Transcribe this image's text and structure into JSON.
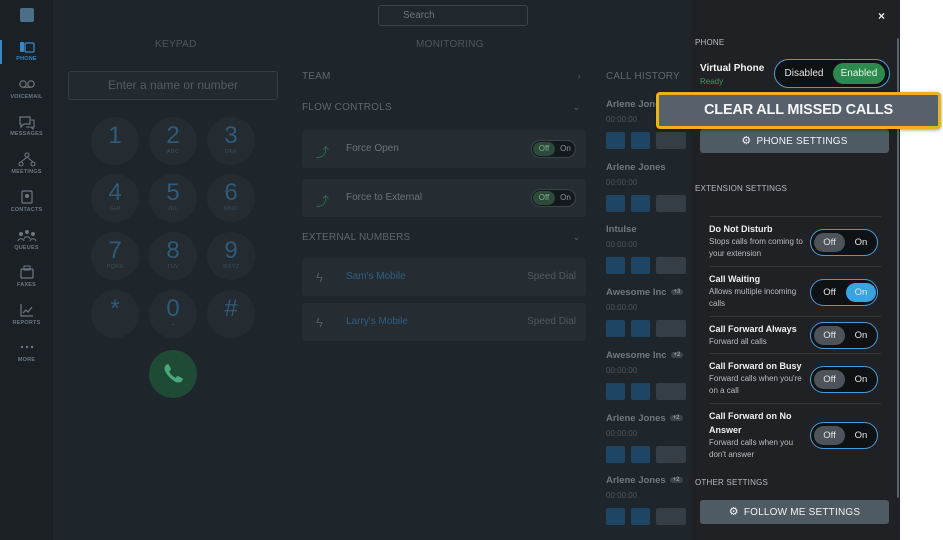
{
  "search": {
    "placeholder": "Search"
  },
  "tabs": [
    "KEYPAD",
    "MONITORING"
  ],
  "nav": [
    {
      "label": "PHONE",
      "icon": "phone-icon"
    },
    {
      "label": "VOICEMAIL",
      "icon": "voicemail-icon"
    },
    {
      "label": "MESSAGES",
      "icon": "messages-icon"
    },
    {
      "label": "MEETINGS",
      "icon": "meetings-icon"
    },
    {
      "label": "CONTACTS",
      "icon": "contacts-icon"
    },
    {
      "label": "QUEUES",
      "icon": "queues-icon"
    },
    {
      "label": "FAXES",
      "icon": "faxes-icon"
    },
    {
      "label": "REPORTS",
      "icon": "reports-icon"
    },
    {
      "label": "MORE",
      "icon": "more-icon"
    }
  ],
  "keypad": {
    "placeholder": "Enter a name or number",
    "keys": [
      {
        "d": "1",
        "s": ""
      },
      {
        "d": "2",
        "s": "ABC"
      },
      {
        "d": "3",
        "s": "DEF"
      },
      {
        "d": "4",
        "s": "GHI"
      },
      {
        "d": "5",
        "s": "JKL"
      },
      {
        "d": "6",
        "s": "MNO"
      },
      {
        "d": "7",
        "s": "PQRS"
      },
      {
        "d": "8",
        "s": "TUV"
      },
      {
        "d": "9",
        "s": "WXYZ"
      },
      {
        "d": "*",
        "s": ""
      },
      {
        "d": "0",
        "s": "+"
      },
      {
        "d": "#",
        "s": ""
      }
    ]
  },
  "monitoring": {
    "team": "TEAM",
    "flow_controls": "FLOW CONTROLS",
    "flows": [
      {
        "label": "Force Open",
        "off": "Off",
        "on": "On"
      },
      {
        "label": "Force to External",
        "off": "Off",
        "on": "On"
      }
    ],
    "external_numbers": "EXTERNAL NUMBERS",
    "externals": [
      {
        "label": "Sam's Mobile",
        "tag": "Speed Dial"
      },
      {
        "label": "Larry's Mobile",
        "tag": "Speed Dial"
      }
    ]
  },
  "call_history": {
    "title": "CALL HISTORY",
    "items": [
      {
        "name": "Arlene Jone",
        "time": "00:00:00",
        "badge": ""
      },
      {
        "name": "Arlene Jones",
        "time": "00:00:00",
        "badge": ""
      },
      {
        "name": "Intulse",
        "time": "00:00:00",
        "badge": ""
      },
      {
        "name": "Awesome Inc",
        "time": "00:00:00",
        "badge": "+3"
      },
      {
        "name": "Awesome Inc",
        "time": "00:00:00",
        "badge": "+2"
      },
      {
        "name": "Arlene Jones",
        "time": "00:00:00",
        "badge": "+2"
      },
      {
        "name": "Arlene Jones",
        "time": "00:00:00",
        "badge": "+2"
      }
    ]
  },
  "panel": {
    "close": "×",
    "phone_heading": "PHONE",
    "virtual_phone": {
      "label": "Virtual Phone",
      "status": "Ready",
      "disabled": "Disabled",
      "enabled": "Enabled"
    },
    "clear_missed": "CLEAR ALL MISSED CALLS",
    "phone_settings": "PHONE SETTINGS",
    "extension_heading": "EXTENSION SETTINGS",
    "settings": [
      {
        "title": "Do Not Disturb",
        "desc": "Stops calls from coming to your extension",
        "off": "Off",
        "on": "On",
        "state": "on"
      },
      {
        "title": "Call Waiting",
        "desc": "Allows multiple incoming calls",
        "off": "Off",
        "on": "On",
        "state": "on"
      },
      {
        "title": "Call Forward Always",
        "desc": "Forward all calls",
        "off": "Off",
        "on": "On",
        "state": "off"
      },
      {
        "title": "Call Forward on Busy",
        "desc": "Forward calls when you're on a call",
        "off": "Off",
        "on": "On",
        "state": "off"
      },
      {
        "title": "Call Forward on No Answer",
        "desc": "Forward calls when you don't answer",
        "off": "Off",
        "on": "On",
        "state": "off"
      }
    ],
    "other_heading": "OTHER SETTINGS",
    "follow_me": "FOLLOW ME SETTINGS"
  },
  "colors": {
    "accent": "#39a5e0",
    "enabled": "#2d8a4e",
    "highlight": "#e8b321"
  }
}
